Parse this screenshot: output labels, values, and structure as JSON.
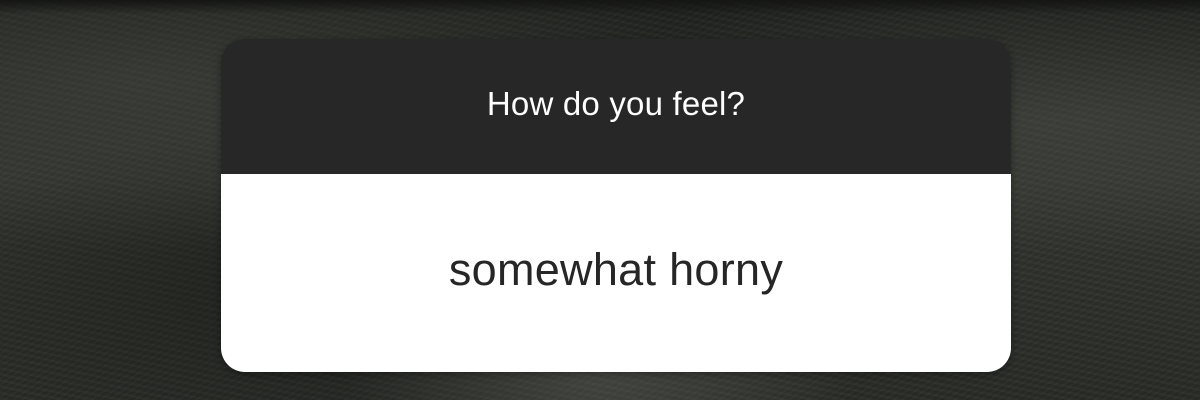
{
  "question_sticker": {
    "question": "How do you feel?",
    "answer": "somewhat horny"
  },
  "colors": {
    "header_background": "#272727",
    "body_background": "#ffffff",
    "question_text": "#ffffff",
    "answer_text": "#262626"
  }
}
